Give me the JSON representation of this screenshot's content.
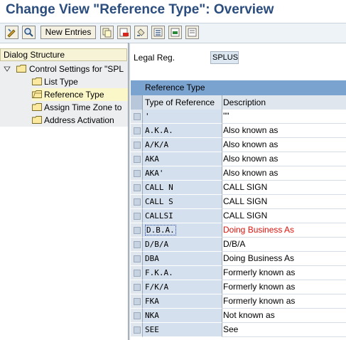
{
  "window": {
    "title": "Change View \"Reference Type\": Overview"
  },
  "toolbar": {
    "new_entries_label": "New Entries",
    "icons": [
      "display-change-icon",
      "details-icon",
      "copy-icon",
      "delete-icon",
      "undo-icon",
      "select-all-icon",
      "select-block-icon",
      "deselect-all-icon"
    ]
  },
  "dialog_structure": {
    "header": "Dialog Structure",
    "root": "Control Settings for \"SPL",
    "items": [
      {
        "label": "List Type",
        "selected": false
      },
      {
        "label": "Reference Type",
        "selected": true
      },
      {
        "label": "Assign Time Zone to",
        "selected": false
      },
      {
        "label": "Address Activation",
        "selected": false
      }
    ]
  },
  "filter": {
    "label": "Legal Reg.",
    "value": "SPLUS"
  },
  "table": {
    "title": "Reference Type",
    "columns": [
      "Type of Reference",
      "Description"
    ],
    "rows": [
      {
        "type": "'",
        "desc": "\"\""
      },
      {
        "type": "A.K.A.",
        "desc": "Also known as"
      },
      {
        "type": "A/K/A",
        "desc": "Also known as"
      },
      {
        "type": "AKA",
        "desc": "Also known as"
      },
      {
        "type": "AKA'",
        "desc": "Also known as"
      },
      {
        "type": "CALL N",
        "desc": "CALL SIGN"
      },
      {
        "type": "CALL S",
        "desc": "CALL SIGN"
      },
      {
        "type": "CALLSI",
        "desc": "CALL SIGN"
      },
      {
        "type": "D.B.A.",
        "desc": "Doing Business As"
      },
      {
        "type": "D/B/A",
        "desc": "D/B/A"
      },
      {
        "type": "DBA",
        "desc": "Doing Business As"
      },
      {
        "type": "F.K.A.",
        "desc": "Formerly known as"
      },
      {
        "type": "F/K/A",
        "desc": "Formerly known as"
      },
      {
        "type": "FKA",
        "desc": "Formerly known as"
      },
      {
        "type": "NKA",
        "desc": "Not known as"
      },
      {
        "type": "SEE",
        "desc": "See"
      }
    ]
  },
  "colors": {
    "title_text": "#2a4d7e",
    "highlight_row_text": "#e3120b",
    "table_header": "#7ba3d0"
  }
}
